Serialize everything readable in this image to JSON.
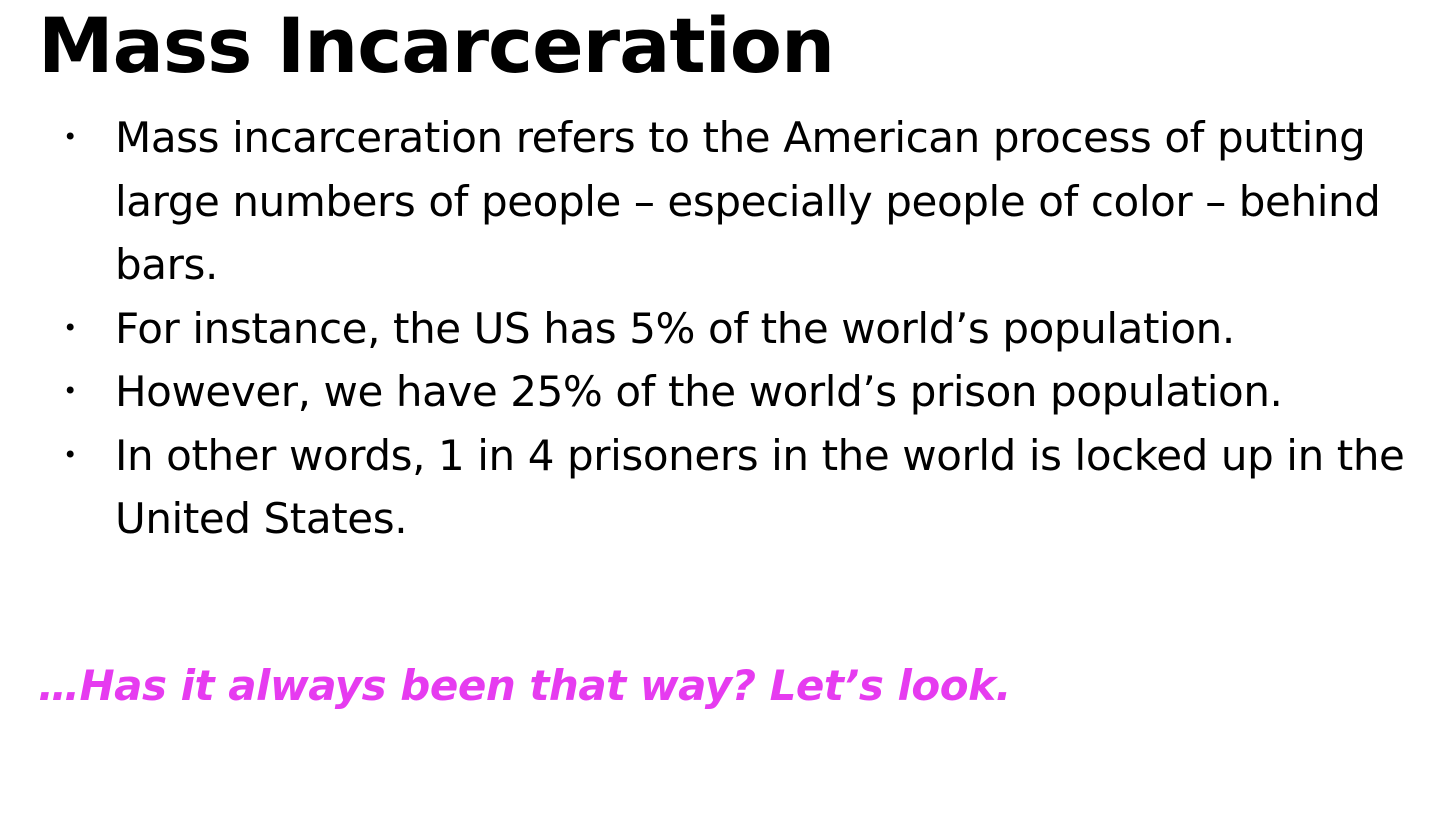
{
  "slide": {
    "title": "Mass Incarceration",
    "bullet_glyph": "•",
    "bullets": [
      {
        "text": "Mass incarceration refers to the American process of putting large numbers of people – especially people of color – behind bars."
      },
      {
        "text": "For instance, the US has 5% of the world’s population."
      },
      {
        "text": "However, we have 25% of the world’s prison population."
      },
      {
        "text": "In other words, 1 in 4 prisoners in the world is locked up in the United States."
      }
    ],
    "closing_line": "…Has it always been that way? Let’s look.",
    "colors": {
      "background": "#ffffff",
      "text": "#000000",
      "accent": "#e63bf0"
    }
  }
}
